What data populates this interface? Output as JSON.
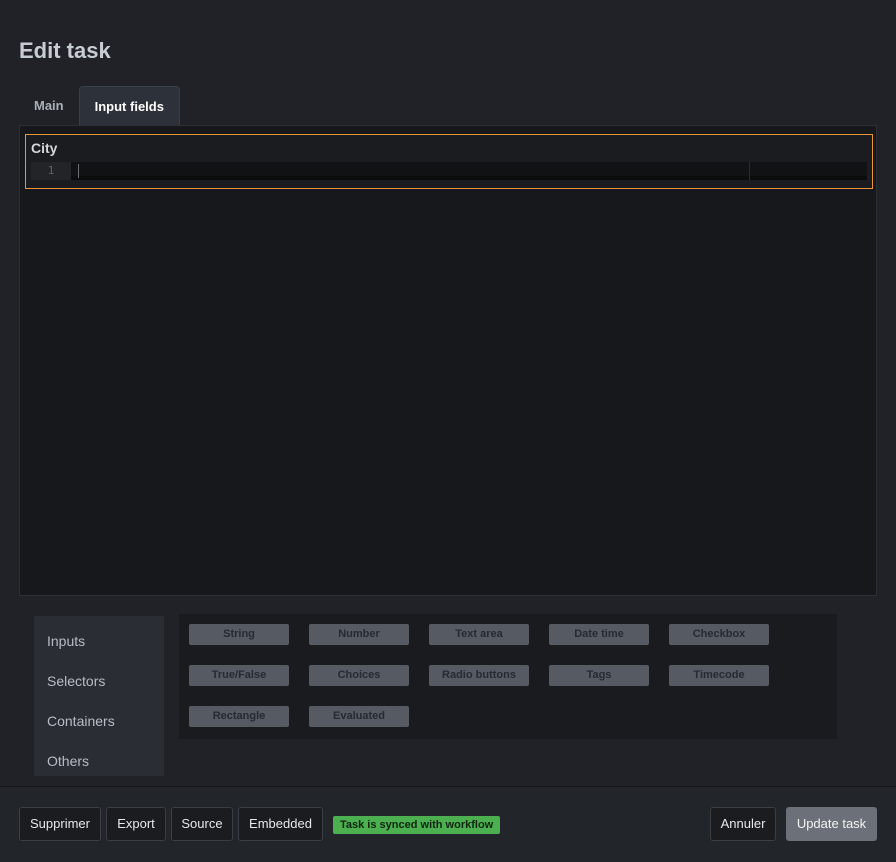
{
  "modal": {
    "title": "Edit task"
  },
  "tabs": [
    {
      "label": "Main",
      "active": false
    },
    {
      "label": "Input fields",
      "active": true
    }
  ],
  "editor": {
    "field_label": "City",
    "line_number": "1",
    "value": ""
  },
  "palette": {
    "categories": [
      "Inputs",
      "Selectors",
      "Containers",
      "Others"
    ],
    "items": [
      "String",
      "Number",
      "Text area",
      "Date time",
      "Checkbox",
      "True/False",
      "Choices",
      "Radio buttons",
      "Tags",
      "Timecode",
      "Rectangle",
      "Evaluated"
    ]
  },
  "footer": {
    "delete_label": "Supprimer",
    "export_label": "Export",
    "source_label": "Source",
    "embedded_label": "Embedded",
    "sync_status": "Task is synced with workflow",
    "cancel_label": "Annuler",
    "update_label": "Update task"
  },
  "colors": {
    "accent_focus": "#e8963a",
    "sync_badge": "#4caf50",
    "background": "#202227"
  }
}
